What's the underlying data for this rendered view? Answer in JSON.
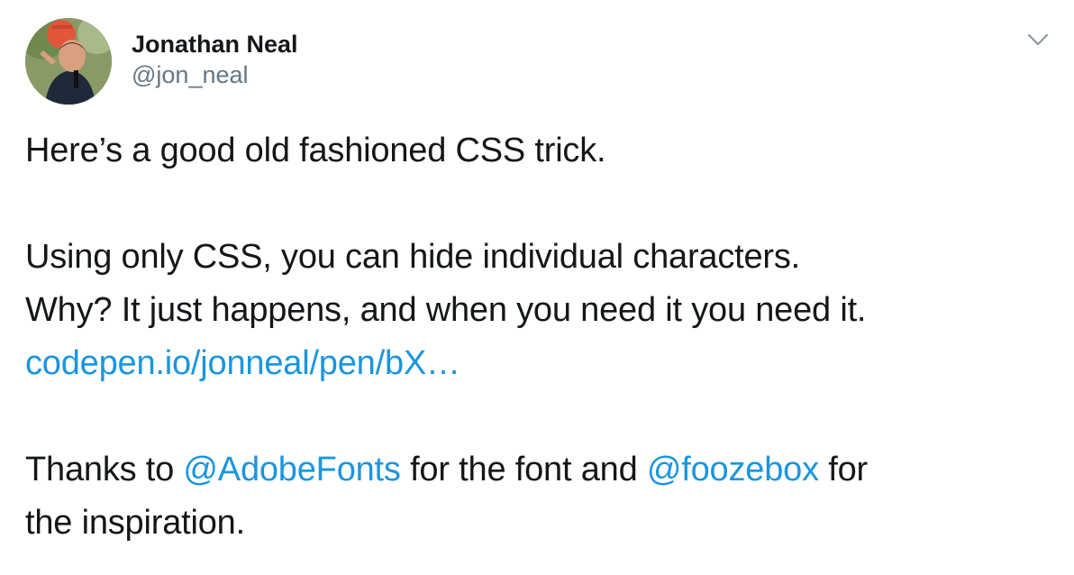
{
  "author": {
    "display_name": "Jonathan Neal",
    "handle": "@jon_neal",
    "avatar_icon": "user-avatar-icon"
  },
  "menu": {
    "caret_icon": "chevron-down-icon"
  },
  "tweet": {
    "line1": "Here’s a good old fashioned CSS trick.",
    "line2": "Using only CSS, you can hide individual characters.",
    "line3": "Why? It just happens, and when you need it you need it.",
    "link": "codepen.io/jonneal/pen/bX…",
    "line4_pre": "Thanks to ",
    "mention1": "@AdobeFonts",
    "line4_mid": " for the font and ",
    "mention2": "@foozebox",
    "line4_post": " for",
    "line5": "the inspiration."
  },
  "colors": {
    "text": "#14171a",
    "secondary": "#657786",
    "link": "#1b95e0"
  }
}
